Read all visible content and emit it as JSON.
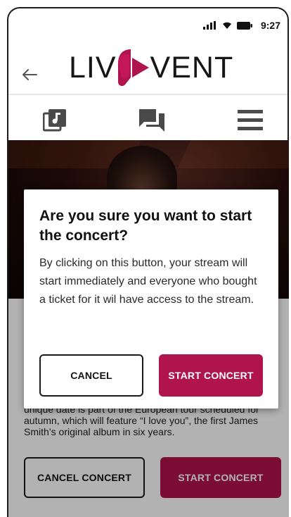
{
  "status_bar": {
    "time": "9:27",
    "icons": [
      "signal-icon",
      "wifi-icon",
      "battery-icon"
    ]
  },
  "header": {
    "back_icon": "arrow-left-icon",
    "logo_left": "LIV",
    "logo_right": "VENT"
  },
  "tabs": [
    {
      "icon": "music-library-icon"
    },
    {
      "icon": "chat-icon"
    },
    {
      "icon": "menu-icon"
    }
  ],
  "concert": {
    "description": "unique date is part of the European tour scheduled for autumn, which will feature “I love you”, the first James Smith’s original album in six years.",
    "cancel_label": "CANCEL CONCERT",
    "start_label": "START CONCERT"
  },
  "dialog": {
    "title": "Are you sure you want to start the concert?",
    "body": "By clicking on this button, your stream will start immediately and everyone who bought a ticket for it wil have access to the stream.",
    "cancel_label": "CANCEL",
    "confirm_label": "START CONCERT"
  },
  "colors": {
    "brand": "#b0144c",
    "text": "#111111"
  }
}
